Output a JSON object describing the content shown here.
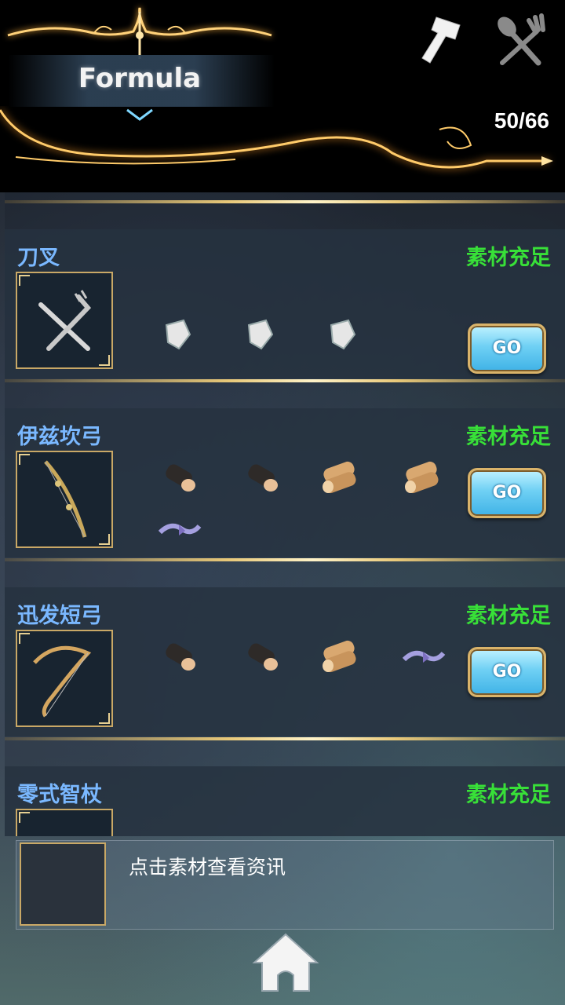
{
  "header": {
    "title": "Formula",
    "count": "50/66"
  },
  "toolbar": {
    "smith_icon": "hammer-icon",
    "cook_icon": "fork-spoon-icon"
  },
  "recipes": [
    {
      "name": "刀叉",
      "status": "素材充足",
      "go": "GO",
      "materials": [
        "crystal-shard-icon",
        "crystal-shard-icon",
        "crystal-shard-icon"
      ]
    },
    {
      "name": "伊兹坎弓",
      "status": "素材充足",
      "go": "GO",
      "materials": [
        "dark-log-icon",
        "dark-log-icon",
        "wood-logs-icon",
        "wood-logs-icon",
        "ribbon-icon"
      ]
    },
    {
      "name": "迅发短弓",
      "status": "素材充足",
      "go": "GO",
      "materials": [
        "dark-log-icon",
        "dark-log-icon",
        "wood-logs-icon",
        "ribbon-icon"
      ]
    },
    {
      "name": "零式智杖",
      "status": "素材充足"
    }
  ],
  "info": {
    "text": "点击素材查看资讯"
  },
  "colors": {
    "name": "#7ab8ff",
    "status": "#38e038",
    "gold": "#e8c879",
    "go": "#6fd0f4"
  }
}
